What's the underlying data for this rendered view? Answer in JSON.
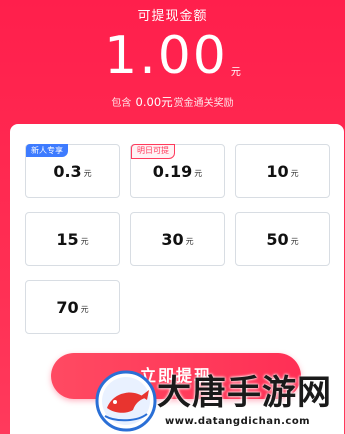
{
  "header": {
    "title": "可提现金额",
    "amount": "1.00",
    "amount_unit": "元"
  },
  "note": {
    "prefix": "包含",
    "amount": "0.00元",
    "suffix": "赏金通关奖励"
  },
  "options": [
    {
      "value": "0.3",
      "unit": "元",
      "badge": "新人专享",
      "badge_style": "blue"
    },
    {
      "value": "0.19",
      "unit": "元",
      "badge": "明日可提",
      "badge_style": "outline"
    },
    {
      "value": "10",
      "unit": "元"
    },
    {
      "value": "15",
      "unit": "元"
    },
    {
      "value": "30",
      "unit": "元"
    },
    {
      "value": "50",
      "unit": "元"
    },
    {
      "value": "70",
      "unit": "元"
    }
  ],
  "withdraw_button": {
    "label": "立即提现"
  },
  "watermark": {
    "brand": "大唐手游网",
    "url": "www.datangdichan.com"
  },
  "colors": {
    "background_red": "#ff2e53",
    "accent_red": "#ff3a5c",
    "badge_blue": "#3d7bff"
  }
}
